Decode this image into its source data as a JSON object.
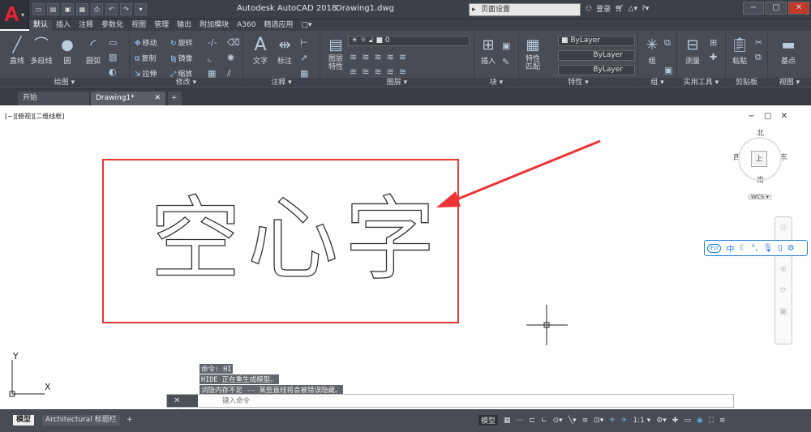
{
  "titlebar": {
    "logo_letter": "A",
    "app_title": "Autodesk AutoCAD 2018",
    "doc_title": "Drawing1.dwg",
    "search_placeholder": "页面设置",
    "login": "登录",
    "qat_icons": [
      "new-icon",
      "open-icon",
      "save-icon",
      "saveas-icon",
      "print-icon",
      "undo-icon",
      "redo-icon",
      "more-icon"
    ]
  },
  "ribbon_tabs": [
    "默认",
    "插入",
    "注释",
    "参数化",
    "视图",
    "管理",
    "输出",
    "附加模块",
    "A360",
    "精选应用",
    "▢▾"
  ],
  "ribbon": {
    "draw": {
      "label": "绘图 ▾",
      "line": "直线",
      "polyline": "多段线",
      "circle": "圆",
      "arc": "圆弧"
    },
    "modify": {
      "label": "修改 ▾",
      "move": "移动",
      "rotate": "旋转",
      "copy": "复制",
      "mirror": "镜像",
      "stretch": "拉伸",
      "scale": "缩放"
    },
    "annotation": {
      "label": "注释 ▾",
      "text": "文字",
      "dim": "标注"
    },
    "layers": {
      "label": "图层 ▾",
      "props": "图层\n特性",
      "layer_value": "0"
    },
    "block": {
      "label": "块 ▾",
      "insert": "插入"
    },
    "properties": {
      "label": "特性 ▾",
      "match": "特性\n匹配",
      "bylayer1": "ByLayer",
      "bylayer2": "ByLayer",
      "bylayer3": "ByLayer"
    },
    "groups": {
      "label": "组 ▾",
      "group": "组"
    },
    "utilities": {
      "label": "实用工具 ▾",
      "measure": "测量"
    },
    "clipboard": {
      "label": "剪贴板",
      "paste": "粘贴"
    },
    "base": {
      "label": "视图 ▾",
      "base": "基点"
    }
  },
  "file_tabs": {
    "start": "开始",
    "drawing": "Drawing1*",
    "add": "+"
  },
  "viewport": {
    "label": "[−][俯视][二维线框]",
    "controls": "− ▢ ✕",
    "viewcube": {
      "north": "北",
      "south": "南",
      "east": "东",
      "west": "西",
      "top": "上",
      "wcs": "WCS ▾"
    }
  },
  "drawing": {
    "hollow_text": "空心字"
  },
  "ime": {
    "brand": "iFLY",
    "lang": "中"
  },
  "command": {
    "history": [
      "命令: HI",
      "HIDE 正在重生成模型。",
      "消隐内存不足 -- 某些直线将会被错误隐藏。"
    ],
    "placeholder": "键入命令"
  },
  "status": {
    "model_tab": "模型",
    "layout_tab": "Architectural 标题栏",
    "add_tab": "+",
    "mode": "模型",
    "scale": "1:1 ▾"
  },
  "colors": {
    "accent_red": "#e33333",
    "ribbon_bg": "#474c55",
    "ime_blue": "#1e7fe0"
  }
}
